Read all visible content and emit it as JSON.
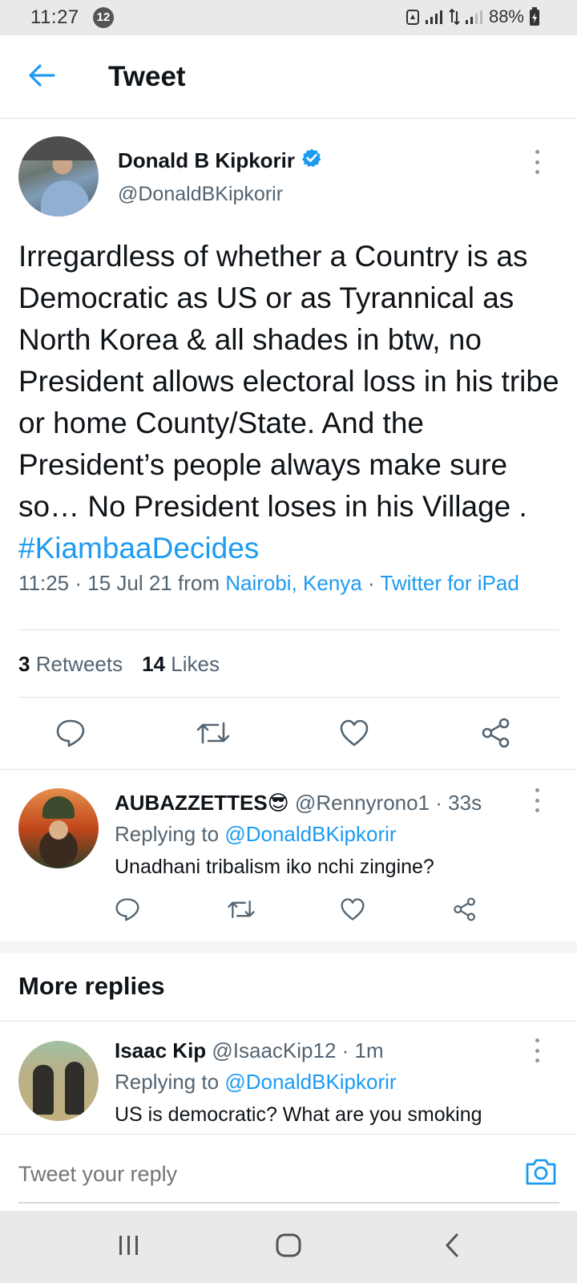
{
  "status_bar": {
    "time": "11:27",
    "notification_count": "12",
    "battery": "88%"
  },
  "header": {
    "title": "Tweet"
  },
  "tweet": {
    "author_name": "Donald B Kipkorir",
    "author_handle": "@DonaldBKipkorir",
    "text": "Irregardless of whether a Country is as Democratic as US or as Tyrannical as North Korea & all shades in btw, no President allows electoral loss in his tribe or home County/State. And the President’s people always make sure so… No President loses in his Village . ",
    "hashtag": "#KiambaaDecides",
    "time_date": "11:25 · 15 Jul 21 from ",
    "location": "Nairobi, Kenya",
    "separator": " · ",
    "source": "Twitter for iPad",
    "retweets_count": "3",
    "retweets_label": "Retweets",
    "likes_count": "14",
    "likes_label": "Likes"
  },
  "replies": [
    {
      "name": "AUBAZZETTES😎",
      "handle_time": " @Rennyrono1 · 33s",
      "replying_prefix": "Replying to ",
      "replying_to": "@DonaldBKipkorir",
      "text": "Unadhani tribalism iko nchi zingine?"
    }
  ],
  "more_replies": {
    "heading": "More replies",
    "items": [
      {
        "name": "Isaac Kip",
        "handle_time": " @IsaacKip12 · 1m",
        "replying_prefix": "Replying to ",
        "replying_to": "@DonaldBKipkorir",
        "text": "US is democratic? What are you smoking"
      }
    ]
  },
  "composer": {
    "placeholder": "Tweet your reply"
  },
  "icons": {
    "back": "arrow-left-icon",
    "verified": "verified-badge-icon",
    "reply": "comment-icon",
    "retweet": "retweet-icon",
    "like": "heart-icon",
    "share": "share-icon",
    "camera": "camera-icon"
  },
  "colors": {
    "accent": "#1d9bf0",
    "text_primary": "#0f1419",
    "text_secondary": "#536471"
  }
}
